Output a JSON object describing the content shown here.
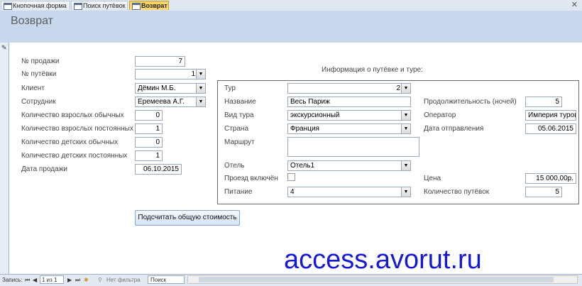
{
  "tabs": [
    {
      "label": "Кнопочная форма"
    },
    {
      "label": "Поиск путёвок"
    },
    {
      "label": "Возврат"
    }
  ],
  "form": {
    "title": "Возврат"
  },
  "left": {
    "sale_no": {
      "label": "№ продажи",
      "value": "7"
    },
    "voucher_no": {
      "label": "№ путёвки",
      "value": "1"
    },
    "client": {
      "label": "Клиент",
      "value": "Дёмин М.Б."
    },
    "employee": {
      "label": "Сотрудник",
      "value": "Еремеева А.Г."
    },
    "adults_regular": {
      "label": "Количество взрослых обычных",
      "value": "0"
    },
    "adults_permanent": {
      "label": "Количество взрослых постоянных",
      "value": "1"
    },
    "children_regular": {
      "label": "Количество детских обычных",
      "value": "0"
    },
    "children_permanent": {
      "label": "Количество детских постоянных",
      "value": "1"
    },
    "sale_date": {
      "label": "Дата продажи",
      "value": "06.10.2015"
    }
  },
  "info": {
    "heading": "Информация о путёвке и туре:",
    "tour": {
      "label": "Тур",
      "value": "2"
    },
    "name": {
      "label": "Название",
      "value": "Весь Париж"
    },
    "tour_type": {
      "label": "Вид тура",
      "value": "экскурсионный"
    },
    "country": {
      "label": "Страна",
      "value": "Франция"
    },
    "route": {
      "label": "Маршрут",
      "value": ""
    },
    "hotel": {
      "label": "Отель",
      "value": "Отель1"
    },
    "travel_included": {
      "label": "Проезд включён",
      "checked": false
    },
    "meals": {
      "label": "Питание",
      "value": "4"
    },
    "duration": {
      "label": "Продолжительность (ночей)",
      "value": "5"
    },
    "operator": {
      "label": "Оператор",
      "value": "Империя туров"
    },
    "departure": {
      "label": "Дата отправления",
      "value": "05.06.2015"
    },
    "price": {
      "label": "Цена",
      "value": "15 000,00р."
    },
    "voucher_count": {
      "label": "Количество путёвок",
      "value": "5"
    }
  },
  "button": {
    "label": "Подсчитать общую стоимость"
  },
  "watermark": "access.avorut.ru",
  "statusbar": {
    "record_label": "Запись:",
    "record_value": "1 из 1",
    "filter_label": "Нет фильтра",
    "search_label": "Поиск"
  }
}
